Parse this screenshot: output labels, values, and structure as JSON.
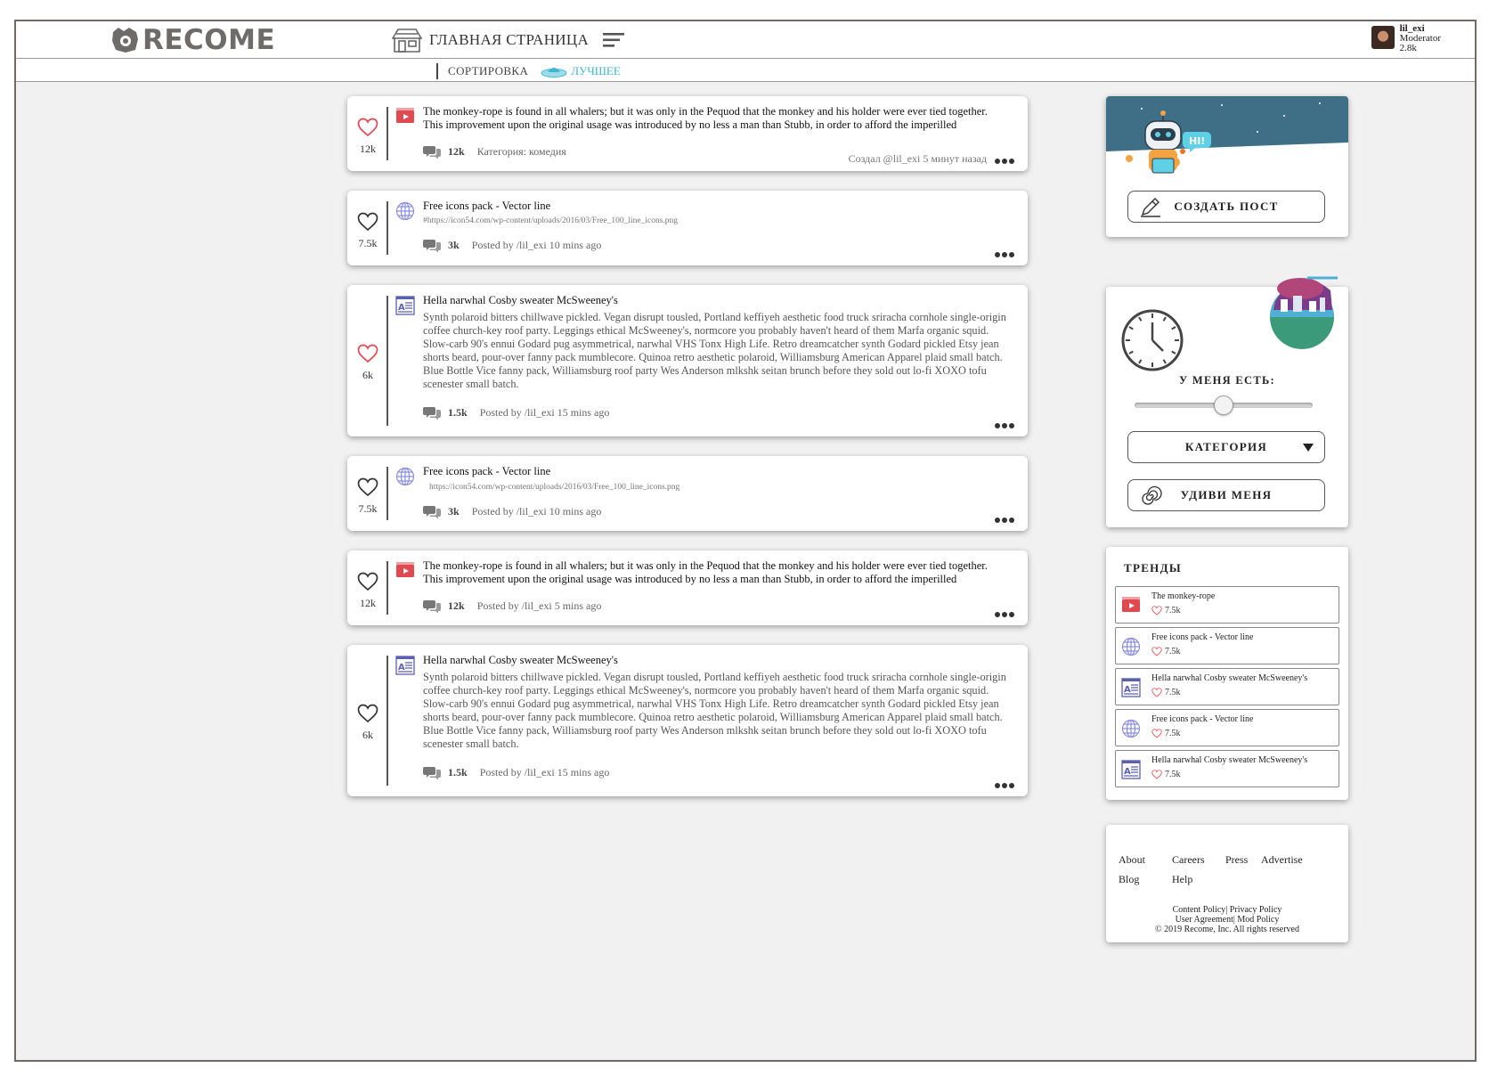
{
  "header": {
    "logo_text": "RECOME",
    "home_title": "ГЛАВНАЯ СТРАНИЦА",
    "user": {
      "name": "lil_exi",
      "role": "Moderator",
      "karma": "2.8k"
    }
  },
  "subheader": {
    "sort_label": "СОРТИРОВКА",
    "active_filter": "ЛУЧШЕЕ"
  },
  "posts": [
    {
      "type": "video-icon",
      "liked": true,
      "likes": "12k",
      "title": "The monkey-rope is found in all whalers; but it was only in the Pequod that the monkey and his holder were ever tied together. This improvement upon the original usage was introduced by no less a man than Stubb, in order to afford the imperilled",
      "comments": "12k",
      "meta": "Категория: комедия",
      "byline": "Создал @lil_exi 5 минут назад"
    },
    {
      "type": "globe-icon",
      "liked": false,
      "likes": "7.5k",
      "title": "Free icons pack - Vector line",
      "link": "#https://icon54.com/wp-content/uploads/2016/03/Free_100_line_icons.png",
      "comments": "3k",
      "meta": "Posted by /lil_exi 10 mins ago"
    },
    {
      "type": "article-icon",
      "liked": true,
      "likes": "6k",
      "title": "Hella narwhal Cosby sweater McSweeney's",
      "body": "Synth polaroid bitters chillwave pickled. Vegan disrupt tousled, Portland keffiyeh aesthetic food truck sriracha cornhole single-origin coffee church-key roof party. Leggings ethical McSweeney's, normcore you probably haven't heard of them Marfa organic squid. Slow-carb 90's ennui Godard pug asymmetrical, narwhal VHS Tonx High Life. Retro dreamcatcher synth Godard pickled Etsy jean shorts beard, pour-over fanny pack mumblecore. Quinoa retro aesthetic polaroid, Williamsburg American Apparel plaid small batch. Blue Bottle Vice fanny pack, Williamsburg roof party Wes Anderson mlkshk seitan brunch before they sold out lo-fi XOXO tofu scenester small batch.",
      "comments": "1.5k",
      "meta": "Posted by /lil_exi 15 mins ago"
    },
    {
      "type": "globe-icon",
      "liked": false,
      "likes": "7.5k",
      "title": "Free icons pack - Vector line",
      "link": "https://icon54.com/wp-content/uploads/2016/03/Free_100_line_icons.png",
      "comments": "3k",
      "meta": "Posted by /lil_exi 10 mins ago"
    },
    {
      "type": "video-icon",
      "liked": false,
      "likes": "12k",
      "title": "The monkey-rope is found in all whalers; but it was only in the Pequod that the monkey and his holder were ever tied together. This improvement upon the original usage was introduced by no less a man than Stubb, in order to afford the imperilled",
      "comments": "12k",
      "meta": "Posted by /lil_exi 5 mins ago"
    },
    {
      "type": "article-icon",
      "liked": false,
      "likes": "6k",
      "title": "Hella narwhal Cosby sweater McSweeney's",
      "body": "Synth polaroid bitters chillwave pickled. Vegan disrupt tousled, Portland keffiyeh aesthetic food truck sriracha cornhole single-origin coffee church-key roof party. Leggings ethical McSweeney's, normcore you probably haven't heard of them Marfa organic squid. Slow-carb 90's ennui Godard pug asymmetrical, narwhal VHS Tonx High Life. Retro dreamcatcher synth Godard pickled Etsy jean shorts beard, pour-over fanny pack mumblecore. Quinoa retro aesthetic polaroid, Williamsburg American Apparel plaid small batch. Blue Bottle Vice fanny pack, Williamsburg roof party Wes Anderson mlkshk seitan brunch before they sold out lo-fi XOXO tofu scenester small batch.",
      "comments": "1.5k",
      "meta": "Posted by /lil_exi 15 mins ago"
    }
  ],
  "sidebar": {
    "create_post_label": "СОЗДАТЬ ПОСТ",
    "robot_greeting": "HI!",
    "time_label": "У МЕНЯ ЕСТЬ:",
    "time_slider_fraction": 0.5,
    "category_label": "КАТЕГОРИЯ",
    "surprise_label": "УДИВИ МЕНЯ",
    "trends_title": "ТРЕНДЫ",
    "trends": [
      {
        "type": "video-icon",
        "title": "The monkey-rope",
        "likes": "7.5k"
      },
      {
        "type": "globe-icon",
        "title": "Free icons pack - Vector line",
        "likes": "7.5k"
      },
      {
        "type": "article-icon",
        "title": "Hella narwhal Cosby sweater McSweeney's",
        "likes": "7.5k"
      },
      {
        "type": "globe-icon",
        "title": "Free icons pack - Vector line",
        "likes": "7.5k"
      },
      {
        "type": "article-icon",
        "title": "Hella narwhal Cosby sweater McSweeney's",
        "likes": "7.5k"
      }
    ]
  },
  "footer": {
    "links": [
      "About",
      "Careers",
      "Press",
      "Advertise",
      "Blog",
      "Help"
    ],
    "legal_line1": "Content Policy| Privacy Policy",
    "legal_line2": "User Agreement| Mod Policy",
    "copyright": "© 2019 Recome, Inc. All rights reserved"
  },
  "colors": {
    "accent": "#3fb6cf",
    "heart": "#e0494f",
    "video": "#e0494f",
    "globe": "#8a8fe0",
    "article": "#5b5fb0"
  }
}
